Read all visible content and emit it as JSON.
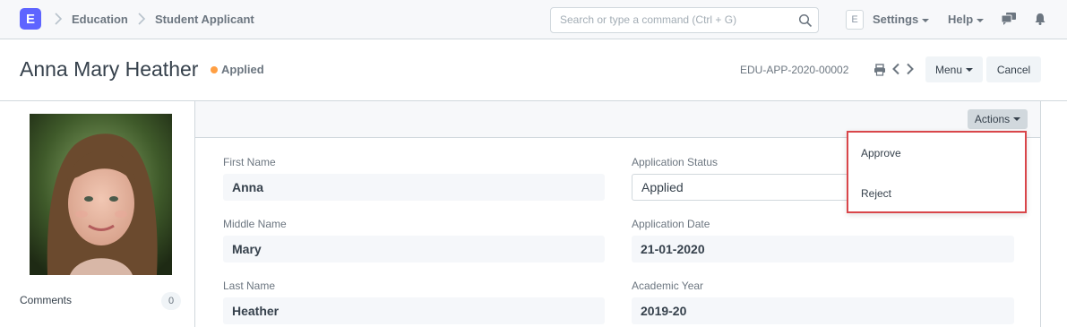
{
  "navbar": {
    "logo_letter": "E",
    "breadcrumbs": [
      "Education",
      "Student Applicant"
    ],
    "search": {
      "placeholder": "Search or type a command (Ctrl + G)"
    },
    "avatar_letter": "E",
    "settings_label": "Settings",
    "help_label": "Help"
  },
  "page": {
    "title": "Anna Mary Heather",
    "status": "Applied",
    "status_color": "#ff9f43",
    "doc_id": "EDU-APP-2020-00002",
    "menu_label": "Menu",
    "cancel_label": "Cancel"
  },
  "sidebar": {
    "comments_label": "Comments",
    "comments_count": "0"
  },
  "form": {
    "actions_label": "Actions",
    "left_fields": [
      {
        "label": "First Name",
        "value": "Anna"
      },
      {
        "label": "Middle Name",
        "value": "Mary"
      },
      {
        "label": "Last Name",
        "value": "Heather"
      }
    ],
    "right_fields": [
      {
        "label": "Application Status",
        "value": "Applied"
      },
      {
        "label": "Application Date",
        "value": "21-01-2020"
      },
      {
        "label": "Academic Year",
        "value": "2019-20"
      }
    ]
  },
  "actions_menu": {
    "items": [
      "Approve",
      "Reject"
    ],
    "highlight_color": "#d9464a"
  }
}
